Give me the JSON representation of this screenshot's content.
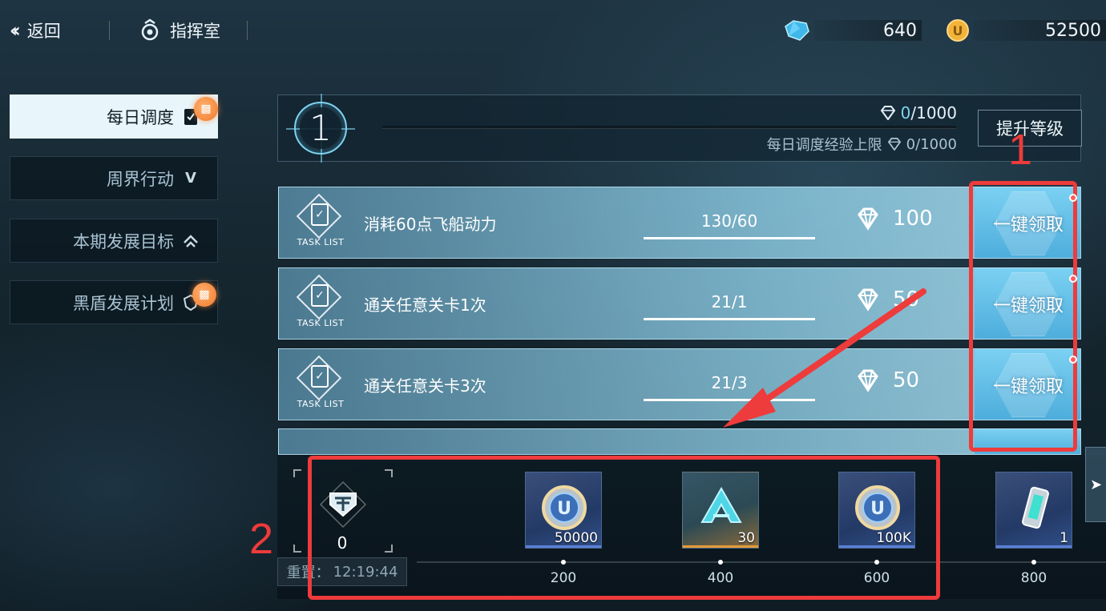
{
  "topbar": {
    "back_label": "返回",
    "section_title": "指挥室",
    "resources": [
      {
        "name": "crystal",
        "icon": "crystal-icon",
        "value": "640"
      },
      {
        "name": "coin",
        "icon": "coin-icon",
        "value": "52500"
      }
    ]
  },
  "nav": {
    "items": [
      {
        "label": "每日调度",
        "icon": "card-icon",
        "active": true,
        "badge": "gift-icon"
      },
      {
        "label": "周界行动",
        "icon": "v-emblem-icon",
        "active": false
      },
      {
        "label": "本期发展目标",
        "icon": "chevron-up-emblem-icon",
        "active": false
      },
      {
        "label": "黑盾发展计划",
        "icon": "shield-emblem-icon",
        "active": false,
        "badge": "gift-icon"
      }
    ]
  },
  "level": {
    "current": "1",
    "exp_current": "0",
    "exp_max": "/1000",
    "cap_label": "每日调度经验上限",
    "cap_value": "0/1000",
    "upgrade_label": "提升等级"
  },
  "tasks": [
    {
      "tag": "TASK LIST",
      "name": "消耗60点飞船动力",
      "progress": "130/60",
      "reward": "100",
      "claim_label": "一键领取"
    },
    {
      "tag": "TASK LIST",
      "name": "通关任意关卡1次",
      "progress": "21/1",
      "reward": "50",
      "claim_label": "一键领取"
    },
    {
      "tag": "TASK LIST",
      "name": "通关任意关卡3次",
      "progress": "21/3",
      "reward": "50",
      "claim_label": "一键领取"
    }
  ],
  "track": {
    "current_points": "0",
    "reset_label": "重置：",
    "reset_time": "12:19:44",
    "rewards": [
      {
        "qty": "50000",
        "milestone": "200",
        "icon": "coin-disc-icon",
        "rarity": "blue"
      },
      {
        "qty": "30",
        "milestone": "400",
        "icon": "delta-emblem-icon",
        "rarity": "orange"
      },
      {
        "qty": "100K",
        "milestone": "600",
        "icon": "coin-disc-icon",
        "rarity": "blue"
      },
      {
        "qty": "1",
        "milestone": "800",
        "icon": "energy-cell-icon",
        "rarity": "blue"
      }
    ]
  },
  "annotations": {
    "label_1": "1",
    "label_2": "2",
    "color": "#ee3b3b"
  },
  "colors": {
    "accent": "#7fd3f0",
    "task_bg": "#96d7f0",
    "nav_active_bg": "#e8f6fb",
    "gift_badge": "#f07a2a"
  }
}
